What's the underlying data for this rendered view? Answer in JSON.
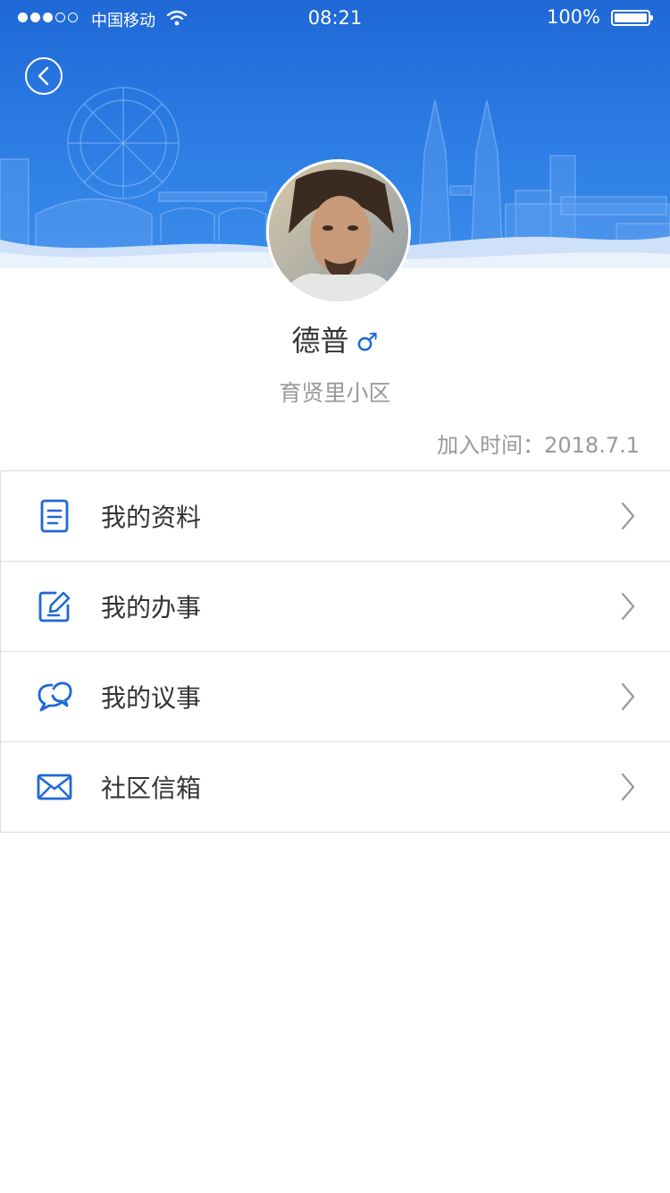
{
  "status_bar": {
    "carrier": "中国移动",
    "time": "08:21",
    "battery": "100%",
    "signal_bars_filled": 3,
    "signal_bars_total": 5
  },
  "header": {
    "back_icon": "chevron-left-circle-icon"
  },
  "profile": {
    "name": "德普",
    "gender_symbol": "♂",
    "community": "育贤里小区",
    "join_date": "加入时间：2018.7.1"
  },
  "menu": {
    "items": [
      {
        "label": "我的资料",
        "icon": "document-icon"
      },
      {
        "label": "我的办事",
        "icon": "edit-icon"
      },
      {
        "label": "我的议事",
        "icon": "chat-bubbles-icon"
      },
      {
        "label": "社区信箱",
        "icon": "mail-icon"
      }
    ]
  },
  "colors": {
    "brand_blue": "#1f68d6",
    "text_dark": "#333333",
    "text_muted": "#999999",
    "divider": "#dddddd"
  }
}
